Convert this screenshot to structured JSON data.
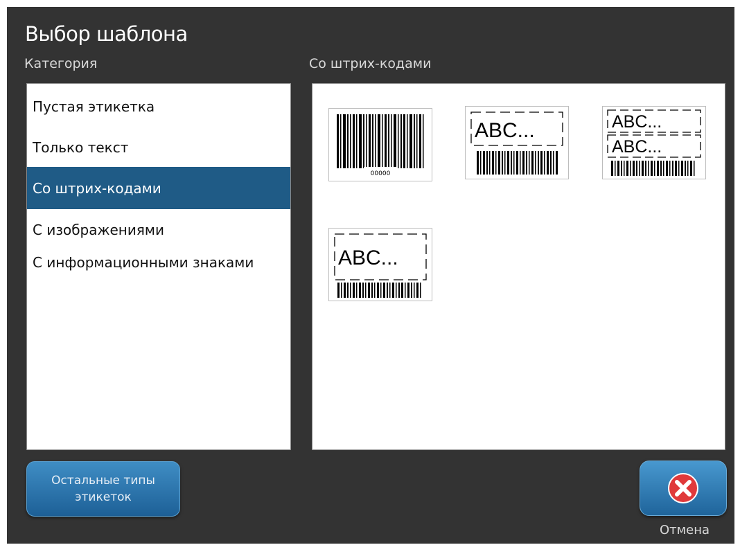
{
  "dialog": {
    "title": "Выбор шаблона"
  },
  "category_label": "Категория",
  "templates_label": "Со штрих-кодами",
  "categories": [
    {
      "label": "Пустая этикетка",
      "selected": false
    },
    {
      "label": "Только текст",
      "selected": false
    },
    {
      "label": "Со штрих-кодами",
      "selected": true
    },
    {
      "label": "С изображениями",
      "selected": false
    },
    {
      "label": "С информационными знаками",
      "selected": false
    }
  ],
  "templates": [
    {
      "icon": "barcode-template-icon",
      "caption": "00000"
    },
    {
      "icon": "text-barcode-template-icon",
      "text": "ABC..."
    },
    {
      "icon": "two-text-barcode-template-icon",
      "text": "ABC...",
      "text2": "ABC..."
    },
    {
      "icon": "text-barcode-template-icon",
      "text": "ABC..."
    }
  ],
  "buttons": {
    "more_label": "Остальные типы этикеток",
    "cancel_label": "Отмена"
  },
  "colors": {
    "background": "#333333",
    "selected_item": "#1f5b86",
    "button_blue": "#2b74ad",
    "cancel_red": "#e0393b"
  }
}
